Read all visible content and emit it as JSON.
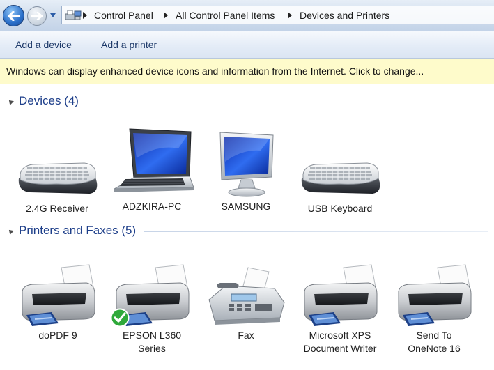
{
  "breadcrumb": {
    "items": [
      "Control Panel",
      "All Control Panel Items",
      "Devices and Printers"
    ]
  },
  "commands": {
    "add_device": "Add a device",
    "add_printer": "Add a printer"
  },
  "infobar": {
    "text": "Windows can display enhanced device icons and information from the Internet. Click to change..."
  },
  "devices": {
    "title": "Devices (4)",
    "items": [
      {
        "label": "2.4G Receiver",
        "icon": "keyboard-icon"
      },
      {
        "label": "ADZKIRA-PC",
        "icon": "laptop-icon"
      },
      {
        "label": "SAMSUNG",
        "icon": "monitor-icon"
      },
      {
        "label": "USB Keyboard",
        "icon": "keyboard-icon"
      }
    ]
  },
  "printers": {
    "title": "Printers and Faxes (5)",
    "items": [
      {
        "label1": "doPDF 9",
        "label2": "",
        "icon": "printer-icon"
      },
      {
        "label1": "EPSON L360",
        "label2": "Series",
        "icon": "printer-icon",
        "default": true
      },
      {
        "label1": "Fax",
        "label2": "",
        "icon": "fax-icon"
      },
      {
        "label1": "Microsoft XPS",
        "label2": "Document Writer",
        "icon": "printer-icon"
      },
      {
        "label1": "Send To",
        "label2": "OneNote 16",
        "icon": "printer-icon"
      }
    ]
  },
  "colors": {
    "group_title": "#1e3f8a",
    "infobar": "#fefbcb",
    "command_text": "#1e3a6a"
  }
}
